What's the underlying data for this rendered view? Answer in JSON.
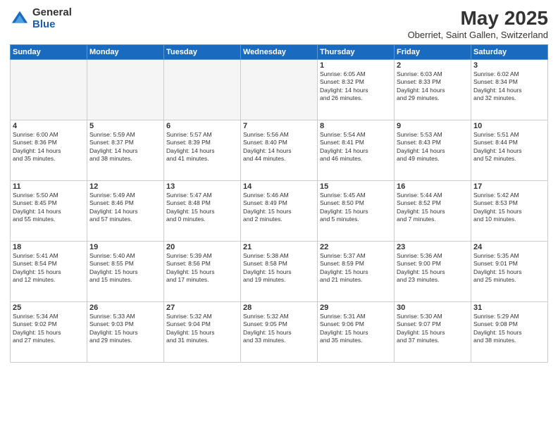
{
  "logo": {
    "general": "General",
    "blue": "Blue"
  },
  "header": {
    "title": "May 2025",
    "subtitle": "Oberriet, Saint Gallen, Switzerland"
  },
  "weekdays": [
    "Sunday",
    "Monday",
    "Tuesday",
    "Wednesday",
    "Thursday",
    "Friday",
    "Saturday"
  ],
  "weeks": [
    [
      {
        "day": "",
        "info": ""
      },
      {
        "day": "",
        "info": ""
      },
      {
        "day": "",
        "info": ""
      },
      {
        "day": "",
        "info": ""
      },
      {
        "day": "1",
        "info": "Sunrise: 6:05 AM\nSunset: 8:32 PM\nDaylight: 14 hours\nand 26 minutes."
      },
      {
        "day": "2",
        "info": "Sunrise: 6:03 AM\nSunset: 8:33 PM\nDaylight: 14 hours\nand 29 minutes."
      },
      {
        "day": "3",
        "info": "Sunrise: 6:02 AM\nSunset: 8:34 PM\nDaylight: 14 hours\nand 32 minutes."
      }
    ],
    [
      {
        "day": "4",
        "info": "Sunrise: 6:00 AM\nSunset: 8:36 PM\nDaylight: 14 hours\nand 35 minutes."
      },
      {
        "day": "5",
        "info": "Sunrise: 5:59 AM\nSunset: 8:37 PM\nDaylight: 14 hours\nand 38 minutes."
      },
      {
        "day": "6",
        "info": "Sunrise: 5:57 AM\nSunset: 8:39 PM\nDaylight: 14 hours\nand 41 minutes."
      },
      {
        "day": "7",
        "info": "Sunrise: 5:56 AM\nSunset: 8:40 PM\nDaylight: 14 hours\nand 44 minutes."
      },
      {
        "day": "8",
        "info": "Sunrise: 5:54 AM\nSunset: 8:41 PM\nDaylight: 14 hours\nand 46 minutes."
      },
      {
        "day": "9",
        "info": "Sunrise: 5:53 AM\nSunset: 8:43 PM\nDaylight: 14 hours\nand 49 minutes."
      },
      {
        "day": "10",
        "info": "Sunrise: 5:51 AM\nSunset: 8:44 PM\nDaylight: 14 hours\nand 52 minutes."
      }
    ],
    [
      {
        "day": "11",
        "info": "Sunrise: 5:50 AM\nSunset: 8:45 PM\nDaylight: 14 hours\nand 55 minutes."
      },
      {
        "day": "12",
        "info": "Sunrise: 5:49 AM\nSunset: 8:46 PM\nDaylight: 14 hours\nand 57 minutes."
      },
      {
        "day": "13",
        "info": "Sunrise: 5:47 AM\nSunset: 8:48 PM\nDaylight: 15 hours\nand 0 minutes."
      },
      {
        "day": "14",
        "info": "Sunrise: 5:46 AM\nSunset: 8:49 PM\nDaylight: 15 hours\nand 2 minutes."
      },
      {
        "day": "15",
        "info": "Sunrise: 5:45 AM\nSunset: 8:50 PM\nDaylight: 15 hours\nand 5 minutes."
      },
      {
        "day": "16",
        "info": "Sunrise: 5:44 AM\nSunset: 8:52 PM\nDaylight: 15 hours\nand 7 minutes."
      },
      {
        "day": "17",
        "info": "Sunrise: 5:42 AM\nSunset: 8:53 PM\nDaylight: 15 hours\nand 10 minutes."
      }
    ],
    [
      {
        "day": "18",
        "info": "Sunrise: 5:41 AM\nSunset: 8:54 PM\nDaylight: 15 hours\nand 12 minutes."
      },
      {
        "day": "19",
        "info": "Sunrise: 5:40 AM\nSunset: 8:55 PM\nDaylight: 15 hours\nand 15 minutes."
      },
      {
        "day": "20",
        "info": "Sunrise: 5:39 AM\nSunset: 8:56 PM\nDaylight: 15 hours\nand 17 minutes."
      },
      {
        "day": "21",
        "info": "Sunrise: 5:38 AM\nSunset: 8:58 PM\nDaylight: 15 hours\nand 19 minutes."
      },
      {
        "day": "22",
        "info": "Sunrise: 5:37 AM\nSunset: 8:59 PM\nDaylight: 15 hours\nand 21 minutes."
      },
      {
        "day": "23",
        "info": "Sunrise: 5:36 AM\nSunset: 9:00 PM\nDaylight: 15 hours\nand 23 minutes."
      },
      {
        "day": "24",
        "info": "Sunrise: 5:35 AM\nSunset: 9:01 PM\nDaylight: 15 hours\nand 25 minutes."
      }
    ],
    [
      {
        "day": "25",
        "info": "Sunrise: 5:34 AM\nSunset: 9:02 PM\nDaylight: 15 hours\nand 27 minutes."
      },
      {
        "day": "26",
        "info": "Sunrise: 5:33 AM\nSunset: 9:03 PM\nDaylight: 15 hours\nand 29 minutes."
      },
      {
        "day": "27",
        "info": "Sunrise: 5:32 AM\nSunset: 9:04 PM\nDaylight: 15 hours\nand 31 minutes."
      },
      {
        "day": "28",
        "info": "Sunrise: 5:32 AM\nSunset: 9:05 PM\nDaylight: 15 hours\nand 33 minutes."
      },
      {
        "day": "29",
        "info": "Sunrise: 5:31 AM\nSunset: 9:06 PM\nDaylight: 15 hours\nand 35 minutes."
      },
      {
        "day": "30",
        "info": "Sunrise: 5:30 AM\nSunset: 9:07 PM\nDaylight: 15 hours\nand 37 minutes."
      },
      {
        "day": "31",
        "info": "Sunrise: 5:29 AM\nSunset: 9:08 PM\nDaylight: 15 hours\nand 38 minutes."
      }
    ]
  ]
}
